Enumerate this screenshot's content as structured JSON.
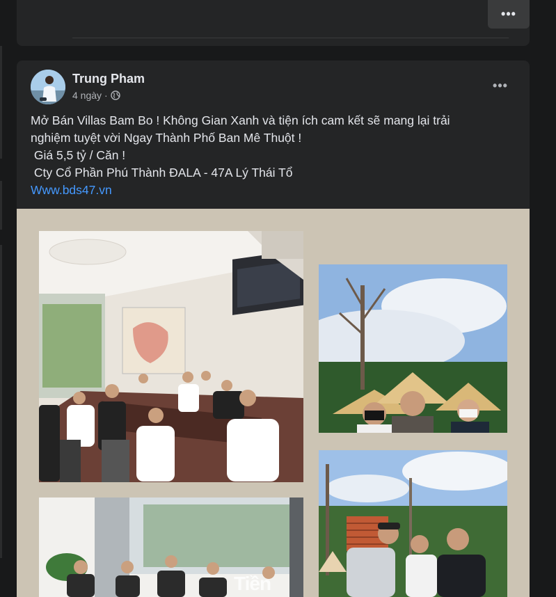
{
  "prev_post": {
    "more_label": "•••"
  },
  "post": {
    "author": "Trung Pham",
    "time": "4 ngày",
    "separator": "·",
    "more_label": "•••",
    "text_lines": [
      "Mở Bán Villas Bam Bo ! Không Gian Xanh và tiện ích cam kết sẽ mang lại trải",
      "nghiệm tuyệt vời Ngay Thành Phố Ban Mê Thuột !",
      " Giá 5,5 tỷ / Căn !",
      " Cty Cổ Phần Phú Thành ĐALA - 47A Lý Thái Tổ"
    ],
    "link": "Www.bds47.vn",
    "photos": {
      "meeting_room": {
        "alt": "Meeting room with sales team"
      },
      "three_women": {
        "alt": "Three women wearing conical hats"
      },
      "office_entrance": {
        "alt": "Office entrance group"
      },
      "site_visit": {
        "alt": "Site visit outdoors"
      },
      "watermark": "Tiền phong"
    }
  },
  "colors": {
    "background": "#18191a",
    "card": "#242526",
    "text": "#e4e6eb",
    "secondary_text": "#b0b3b8",
    "link": "#4599ff",
    "media_background": "#ccc4b4"
  },
  "icons": {
    "privacy": "globe-icon",
    "more": "more-horizontal-icon"
  }
}
